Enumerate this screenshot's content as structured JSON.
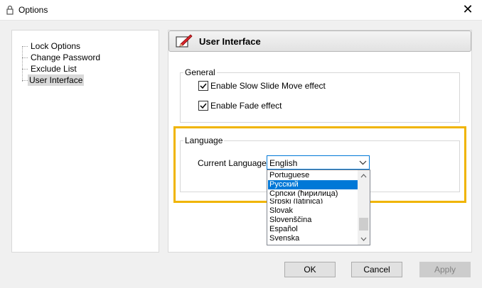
{
  "window": {
    "title": "Options",
    "close_glyph": "✕"
  },
  "tree": {
    "items": [
      {
        "label": "Lock Options",
        "selected": false
      },
      {
        "label": "Change Password",
        "selected": false
      },
      {
        "label": "Exclude List",
        "selected": false
      },
      {
        "label": "User Interface",
        "selected": true
      }
    ]
  },
  "panel": {
    "title": "User Interface",
    "icon": "pencil-note-icon",
    "general": {
      "legend": "General",
      "options": [
        {
          "label": "Enable Slow Slide Move effect",
          "checked": true
        },
        {
          "label": "Enable Fade effect",
          "checked": true
        }
      ]
    },
    "language": {
      "legend": "Language",
      "label": "Current Language",
      "selected": "English",
      "options": [
        "Portuguese",
        "Русский",
        "Српски (ћирилица)",
        "Srpski (latinica)",
        "Slovak",
        "Slovenščina",
        "Español",
        "Svenska"
      ],
      "highlighted_option": "Русский"
    }
  },
  "buttons": {
    "ok": "OK",
    "cancel": "Cancel",
    "apply": "Apply"
  },
  "colors": {
    "highlight_border": "#f0b400",
    "selection": "#0078d7"
  }
}
